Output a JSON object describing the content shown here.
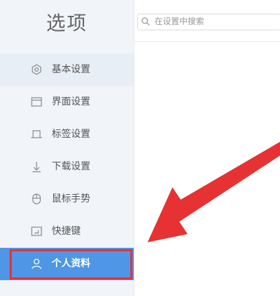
{
  "window": {
    "title": "选项"
  },
  "search": {
    "placeholder": "在设置中搜索"
  },
  "sidebar": {
    "items": [
      {
        "label": "基本设置",
        "icon": "settings-icon"
      },
      {
        "label": "界面设置",
        "icon": "window-icon"
      },
      {
        "label": "标签设置",
        "icon": "tab-icon"
      },
      {
        "label": "下载设置",
        "icon": "download-icon"
      },
      {
        "label": "鼠标手势",
        "icon": "mouse-icon"
      },
      {
        "label": "快捷键",
        "icon": "keyboard-icon"
      },
      {
        "label": "个人资料",
        "icon": "user-icon"
      }
    ]
  },
  "colors": {
    "active": "#4f96e6",
    "annotation": "#e63232"
  }
}
